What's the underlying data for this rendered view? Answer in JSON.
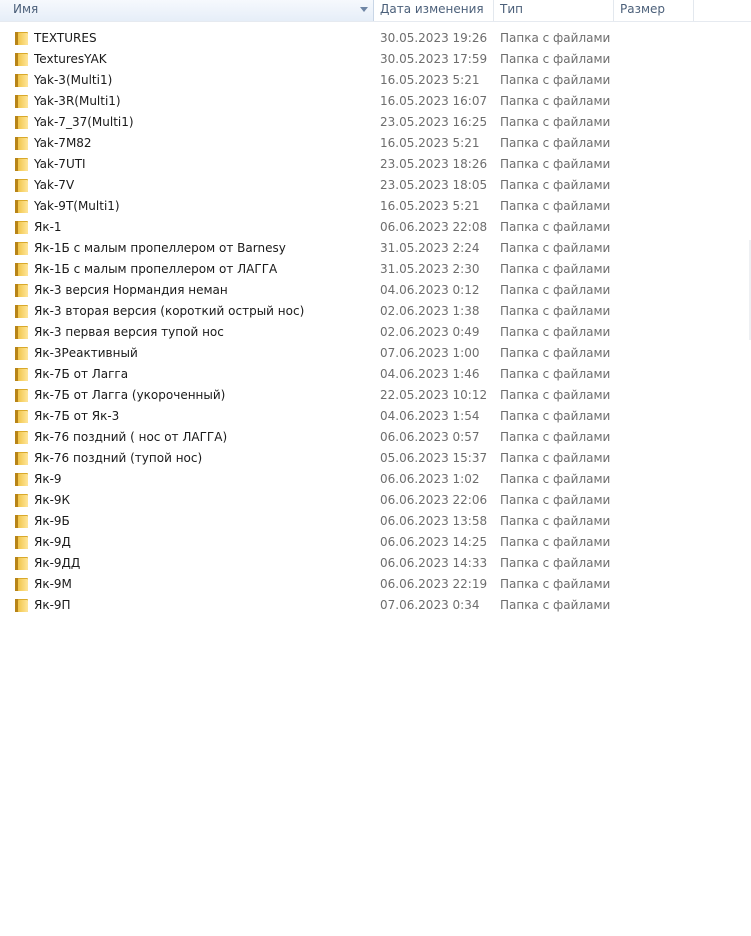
{
  "columns": {
    "name": "Имя",
    "date": "Дата изменения",
    "type": "Тип",
    "size": "Размер"
  },
  "icons": {
    "folder": "folder-icon",
    "sort": "sort-down-arrow-icon"
  },
  "colors": {
    "header_text": "#4c607a",
    "folder": "#f1c54a",
    "secondary_text": "#6d6d6d"
  },
  "files": [
    {
      "name": "TEXTURES",
      "date": "30.05.2023 19:26",
      "type": "Папка с файлами"
    },
    {
      "name": "TexturesYAK",
      "date": "30.05.2023 17:59",
      "type": "Папка с файлами"
    },
    {
      "name": "Yak-3(Multi1)",
      "date": "16.05.2023 5:21",
      "type": "Папка с файлами"
    },
    {
      "name": "Yak-3R(Multi1)",
      "date": "16.05.2023 16:07",
      "type": "Папка с файлами"
    },
    {
      "name": "Yak-7_37(Multi1)",
      "date": "23.05.2023 16:25",
      "type": "Папка с файлами"
    },
    {
      "name": "Yak-7M82",
      "date": "16.05.2023 5:21",
      "type": "Папка с файлами"
    },
    {
      "name": "Yak-7UTI",
      "date": "23.05.2023 18:26",
      "type": "Папка с файлами"
    },
    {
      "name": "Yak-7V",
      "date": "23.05.2023 18:05",
      "type": "Папка с файлами"
    },
    {
      "name": "Yak-9T(Multi1)",
      "date": "16.05.2023 5:21",
      "type": "Папка с файлами"
    },
    {
      "name": "Як-1",
      "date": "06.06.2023 22:08",
      "type": "Папка с файлами"
    },
    {
      "name": "Як-1Б с малым пропеллером от Barnesy",
      "date": "31.05.2023 2:24",
      "type": "Папка с файлами"
    },
    {
      "name": "Як-1Б с малым пропеллером от ЛАГГА",
      "date": "31.05.2023 2:30",
      "type": "Папка с файлами"
    },
    {
      "name": "Як-3 версия Нормандия неман",
      "date": "04.06.2023 0:12",
      "type": "Папка с файлами"
    },
    {
      "name": "Як-3 вторая версия (короткий острый нос)",
      "date": "02.06.2023 1:38",
      "type": "Папка с файлами"
    },
    {
      "name": "Як-3 первая версия тупой нос",
      "date": "02.06.2023 0:49",
      "type": "Папка с файлами"
    },
    {
      "name": "Як-3Реактивный",
      "date": "07.06.2023 1:00",
      "type": "Папка с файлами"
    },
    {
      "name": "Як-7Б от Лагга",
      "date": "04.06.2023 1:46",
      "type": "Папка с файлами"
    },
    {
      "name": "Як-7Б от Лагга (укороченный)",
      "date": "22.05.2023 10:12",
      "type": "Папка с файлами"
    },
    {
      "name": "Як-7Б от Як-3",
      "date": "04.06.2023 1:54",
      "type": "Папка с файлами"
    },
    {
      "name": "Як-76 поздний ( нос от ЛАГГА)",
      "date": "06.06.2023 0:57",
      "type": "Папка с файлами"
    },
    {
      "name": "Як-76 поздний (тупой нос)",
      "date": "05.06.2023 15:37",
      "type": "Папка с файлами"
    },
    {
      "name": "Як-9",
      "date": "06.06.2023 1:02",
      "type": "Папка с файлами"
    },
    {
      "name": "Як-9К",
      "date": "06.06.2023 22:06",
      "type": "Папка с файлами"
    },
    {
      "name": "Як-9Б",
      "date": "06.06.2023 13:58",
      "type": "Папка с файлами"
    },
    {
      "name": "Як-9Д",
      "date": "06.06.2023 14:25",
      "type": "Папка с файлами"
    },
    {
      "name": "Як-9ДД",
      "date": "06.06.2023 14:33",
      "type": "Папка с файлами"
    },
    {
      "name": "Як-9М",
      "date": "06.06.2023 22:19",
      "type": "Папка с файлами"
    },
    {
      "name": "Як-9П",
      "date": "07.06.2023 0:34",
      "type": "Папка с файлами"
    }
  ]
}
